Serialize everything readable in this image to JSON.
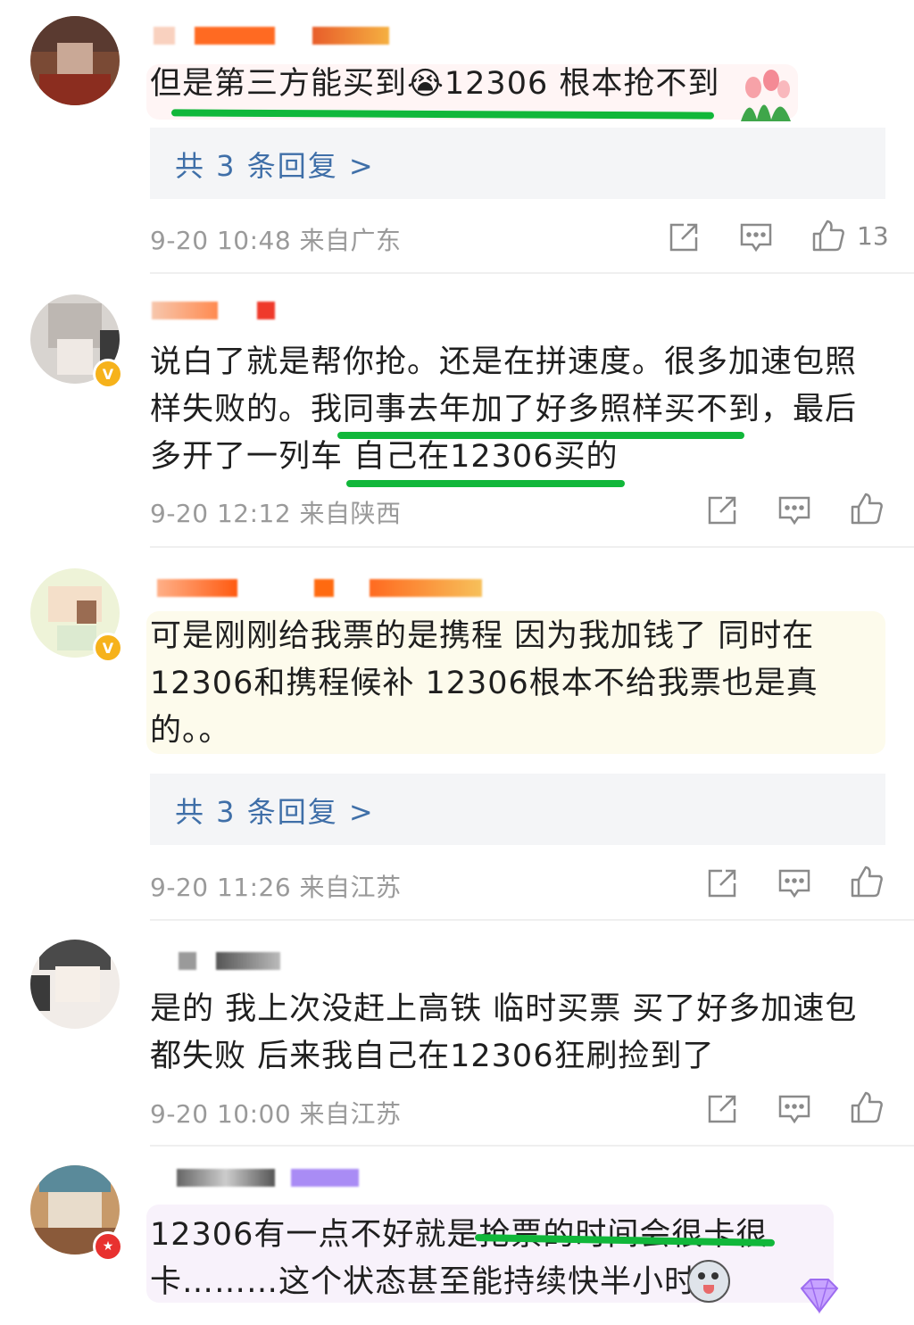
{
  "comments": [
    {
      "text": "但是第三方能买到😭12306 根本抢不到",
      "reply_label": "共 3 条回复 >",
      "meta": "9-20 10:48  来自广东",
      "likes": "13"
    },
    {
      "text": "说白了就是帮你抢。还是在拼速度。很多加速包照样失败的。我同事去年加了好多照样买不到，最后多开了一列车 自己在12306买的",
      "meta": "9-20 12:12  来自陕西"
    },
    {
      "text": "可是刚刚给我票的是携程 因为我加钱了 同时在 12306和携程候补 12306根本不给我票也是真的。。",
      "reply_label": "共 3 条回复 >",
      "meta": "9-20 11:26  来自江苏"
    },
    {
      "text": "是的 我上次没赶上高铁 临时买票 买了好多加速包都失败 后来我自己在12306狂刷捡到了",
      "meta": "9-20 10:00  来自江苏"
    },
    {
      "text": "12306有一点不好就是抢票的时间会很卡很卡………这个状态甚至能持续快半小时"
    }
  ],
  "icons": {
    "share": "share-icon",
    "comment": "comment-icon",
    "like": "like-icon"
  },
  "colors": {
    "underline": "#11b73a",
    "reply_link": "#3f6fa8",
    "meta_text": "#9a9a9a"
  }
}
